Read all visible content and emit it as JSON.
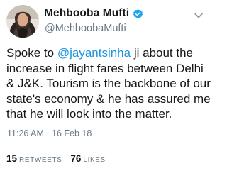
{
  "tweet": {
    "display_name": "Mehbooba Mufti",
    "handle": "@MehboobaMufti",
    "verified": true,
    "text_lines": [
      {
        "before": "Spoke to ",
        "mention": "@jayantsinha",
        "after": " ji about the"
      },
      {
        "text": "increase in flight fares between Delhi"
      },
      {
        "text": "& J&K. Tourism is the backbone of our"
      },
      {
        "text": "state's economy & he has assured me"
      },
      {
        "text": "that he will look into the matter."
      }
    ],
    "timestamp": "11:26 AM · 16 Feb 18",
    "retweets_count": "15",
    "retweets_label": "RETWEETS",
    "likes_count": "76",
    "likes_label": "LIKES"
  },
  "colors": {
    "accent": "#1b95e0",
    "secondary_text": "#657786",
    "verified_badge": "#1da1f2",
    "divider": "#e1e8ed"
  },
  "icons": {
    "verified": "verified-badge-icon",
    "menu": "chevron-down-icon"
  }
}
